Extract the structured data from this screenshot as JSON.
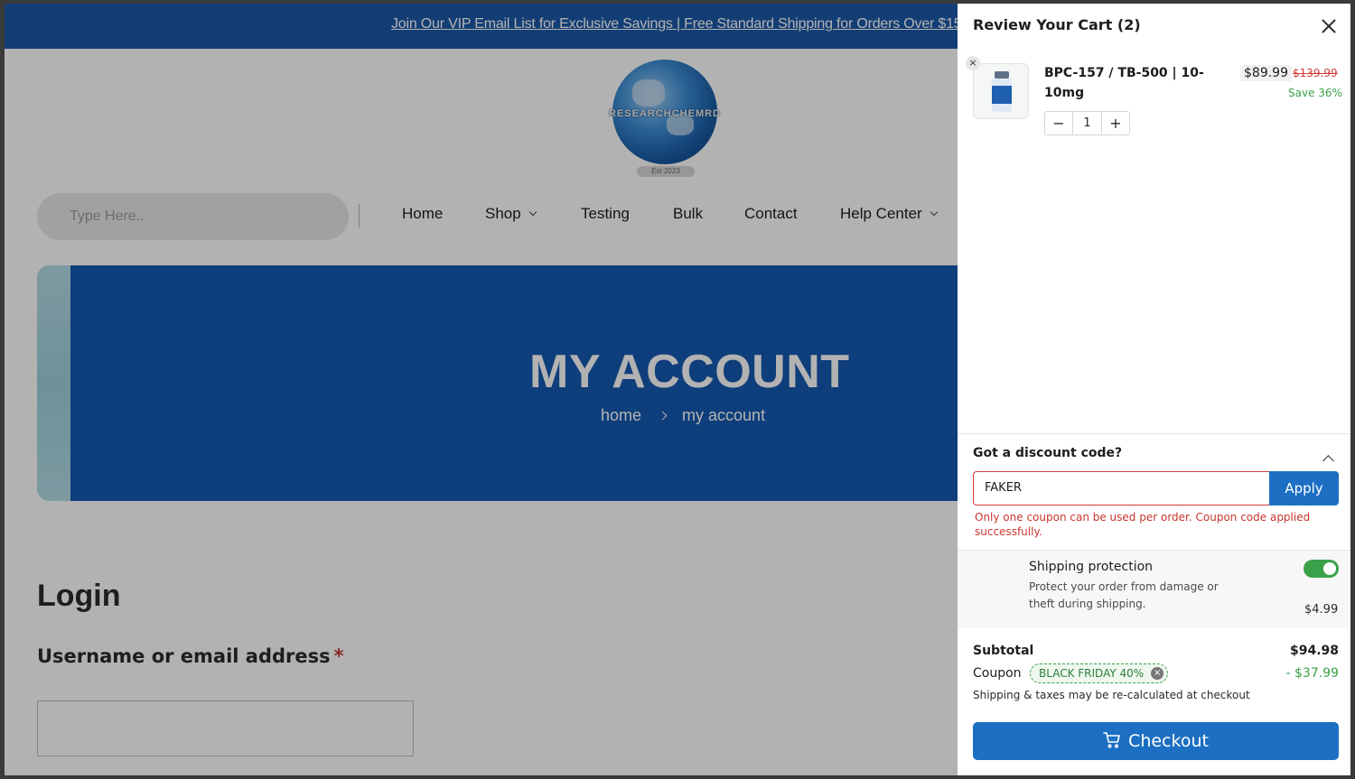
{
  "announcement": "Join Our VIP Email List for Exclusive Savings | Free Standard Shipping for Orders Over $15",
  "logo": {
    "text": "RESEARCHCHEMRD",
    "est": "Est 2023"
  },
  "search": {
    "placeholder": "Type Here.."
  },
  "nav": {
    "items": [
      {
        "label": "Home"
      },
      {
        "label": "Shop"
      },
      {
        "label": "Testing"
      },
      {
        "label": "Bulk"
      },
      {
        "label": "Contact"
      },
      {
        "label": "Help Center"
      }
    ]
  },
  "hero": {
    "title": "MY ACCOUNT",
    "breadcrumb": {
      "home": "home",
      "current": "my account"
    }
  },
  "login": {
    "title": "Login",
    "username_label": "Username or email address",
    "required_mark": "*"
  },
  "cart": {
    "title": "Review Your Cart (2)",
    "remove_icon": "×",
    "items": [
      {
        "name": "BPC-157 / TB-500 | 10-10mg",
        "price": "$89.99",
        "old_price": "$139.99",
        "save": "Save 36%",
        "qty": "1",
        "minus": "−",
        "plus": "+"
      }
    ],
    "discount": {
      "title": "Got a discount code?",
      "value": "FAKER",
      "apply": "Apply",
      "message": "Only one coupon can be used per order. Coupon code applied successfully."
    },
    "shipping_protection": {
      "title": "Shipping protection",
      "description": "Protect your order from damage or theft during shipping.",
      "price": "$4.99",
      "enabled": true
    },
    "totals": {
      "subtotal_label": "Subtotal",
      "subtotal": "$94.98",
      "coupon_label": "Coupon",
      "coupon_code": "BLACK FRIDAY 40%",
      "coupon_remove": "×",
      "coupon_value": "- $37.99",
      "note": "Shipping & taxes may be re-calculated at checkout"
    },
    "checkout": "Checkout"
  },
  "colors": {
    "brand_blue": "#1c5aa8",
    "hero_blue": "#155ab0",
    "button_blue": "#1c6fc2",
    "error_red": "#c8362f",
    "success_green": "#3aa14a"
  }
}
